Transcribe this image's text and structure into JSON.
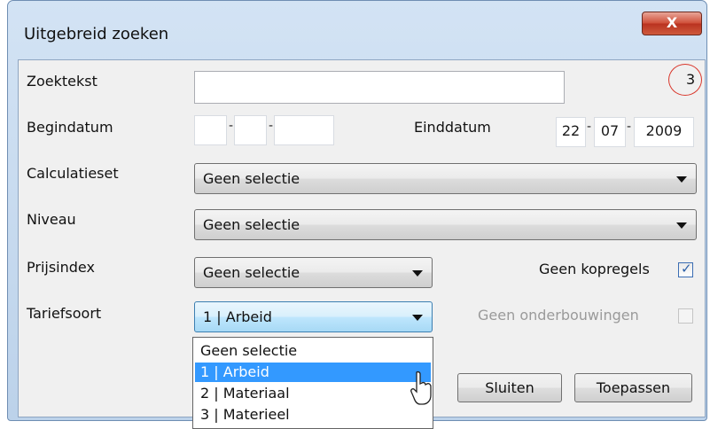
{
  "window": {
    "title": "Uitgebreid zoeken",
    "close_label": "X"
  },
  "form": {
    "zoektekst": {
      "label": "Zoektekst",
      "value": ""
    },
    "counter": "3",
    "begindatum": {
      "label": "Begindatum",
      "day": "",
      "month": "",
      "year": ""
    },
    "einddatum": {
      "label": "Einddatum",
      "day": "22",
      "month": "07",
      "year": "2009"
    },
    "calculatieset": {
      "label": "Calculatieset",
      "selected": "Geen selectie"
    },
    "niveau": {
      "label": "Niveau",
      "selected": "Geen selectie"
    },
    "prijsindex": {
      "label": "Prijsindex",
      "selected": "Geen selectie"
    },
    "tariefsoort": {
      "label": "Tariefsoort",
      "selected": "1 | Arbeid",
      "options": [
        "Geen selectie",
        "1 | Arbeid",
        "2 | Materiaal",
        "3 | Materieel"
      ],
      "highlighted_index": 1
    },
    "geen_kopregels": {
      "label": "Geen kopregels",
      "checked": true
    },
    "geen_onderbouwingen": {
      "label": "Geen onderbouwingen",
      "checked": false,
      "disabled": true
    }
  },
  "buttons": {
    "sluiten": "Sluiten",
    "toepassen": "Toepassen"
  },
  "colors": {
    "selection": "#3399ff",
    "annotation_circle": "#d9362b",
    "close_button": "#c9442f"
  }
}
